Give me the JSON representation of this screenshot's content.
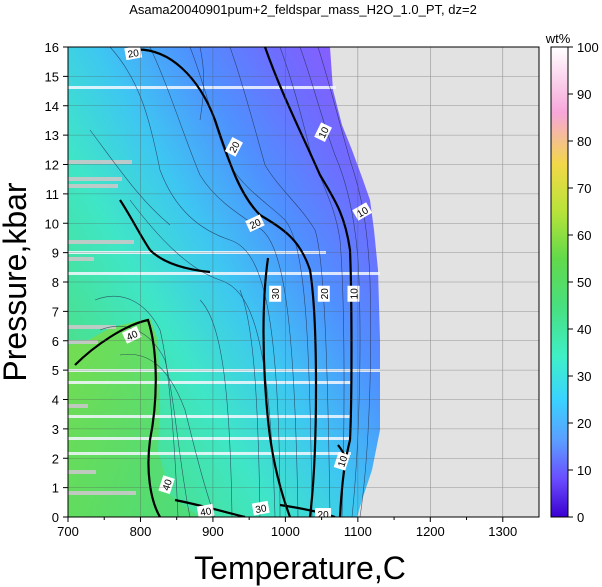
{
  "chart_data": {
    "type": "heatmap",
    "title": "Asama20040901pum+2_feldspar_mass_H2O_1.0_PT, dz=2",
    "xlabel": "Temperature,C",
    "ylabel": "Pressure,kbar",
    "xlim": [
      700,
      1350
    ],
    "ylim": [
      0,
      16
    ],
    "x_ticks": [
      "700",
      "800",
      "900",
      "1000",
      "1100",
      "1200",
      "1300"
    ],
    "y_ticks": [
      "0",
      "1",
      "2",
      "3",
      "4",
      "5",
      "6",
      "7",
      "8",
      "9",
      "10",
      "11",
      "12",
      "13",
      "14",
      "15",
      "16"
    ],
    "grid": true,
    "colorbar": {
      "label": "wt%",
      "range": [
        0,
        100
      ],
      "ticks": [
        "0",
        "10",
        "20",
        "30",
        "40",
        "50",
        "60",
        "70",
        "80",
        "90",
        "100"
      ],
      "colors": [
        "#3b00d0",
        "#7a63ff",
        "#5fa0ff",
        "#38d6ff",
        "#3ff0c0",
        "#49e07a",
        "#5fd84a",
        "#b9e23a",
        "#f0d84a",
        "#f7a8e0",
        "#ffffff"
      ]
    },
    "contour_labels": [
      {
        "text": "10",
        "T": 1052,
        "P": 13.1,
        "rot": -64
      },
      {
        "text": "10",
        "T": 1106,
        "P": 10.4,
        "rot": -30
      },
      {
        "text": "10",
        "T": 1094,
        "P": 7.6,
        "rot": -90
      },
      {
        "text": "10",
        "T": 1078,
        "P": 1.9,
        "rot": -72
      },
      {
        "text": "20",
        "T": 790,
        "P": 15.8,
        "rot": -10
      },
      {
        "text": "20",
        "T": 929,
        "P": 12.6,
        "rot": -62
      },
      {
        "text": "20",
        "T": 958,
        "P": 10.0,
        "rot": -25
      },
      {
        "text": "20",
        "T": 1053,
        "P": 7.6,
        "rot": -90
      },
      {
        "text": "20",
        "T": 1052,
        "P": 0.1,
        "rot": 0
      },
      {
        "text": "30",
        "T": 986,
        "P": 7.6,
        "rot": -90
      },
      {
        "text": "30",
        "T": 966,
        "P": 0.3,
        "rot": -10
      },
      {
        "text": "40",
        "T": 788,
        "P": 6.2,
        "rot": -25
      },
      {
        "text": "40",
        "T": 836,
        "P": 1.1,
        "rot": -72
      },
      {
        "text": "40",
        "T": 890,
        "P": 0.2,
        "rot": -10
      }
    ]
  }
}
